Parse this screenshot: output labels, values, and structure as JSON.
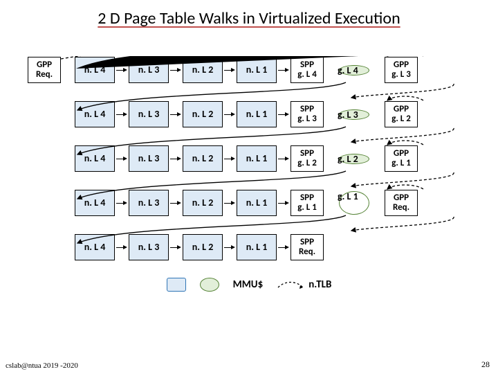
{
  "title": "2 D Page Table Walks in Virtualized Execution",
  "rows": [
    {
      "left": "GPP\nReq.",
      "spp": "SPP\ng. L 4",
      "g": "g. L 4",
      "right": "GPP\ng. L 3"
    },
    {
      "left": "",
      "spp": "SPP\ng. L 3",
      "g": "g. L 3",
      "right": "GPP\ng. L 2"
    },
    {
      "left": "",
      "spp": "SPP\ng. L 2",
      "g": "g. L 2",
      "right": "GPP\ng. L 1"
    },
    {
      "left": "",
      "spp": "SPP\ng. L 1",
      "g": "g. L 1",
      "right": "GPP\nReq."
    },
    {
      "left": "",
      "spp": "SPP\nReq.",
      "g": "",
      "right": ""
    }
  ],
  "n_labels": [
    "n. L 4",
    "n. L 3",
    "n. L 2",
    "n. L 1"
  ],
  "legend": {
    "mmu": "MMU$",
    "ntlb": "n.TLB"
  },
  "footer": {
    "left": "cslab@ntua 2019 -2020",
    "right": "28"
  }
}
